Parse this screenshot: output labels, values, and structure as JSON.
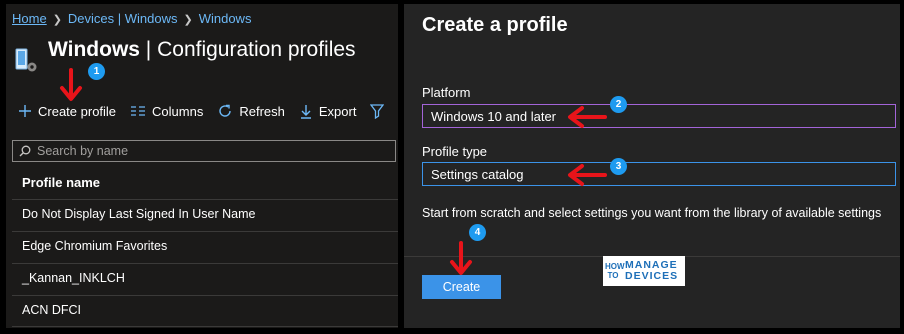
{
  "breadcrumb": {
    "home": "Home",
    "devices": "Devices | Windows",
    "windows": "Windows"
  },
  "page": {
    "title_main": "Windows",
    "title_sep": " | ",
    "title_sub": "Configuration profiles"
  },
  "toolbar": {
    "create_profile": "Create profile",
    "columns": "Columns",
    "refresh": "Refresh",
    "export": "Export"
  },
  "search": {
    "placeholder": "Search by name"
  },
  "table": {
    "column_header": "Profile name",
    "rows": [
      "Do Not Display Last Signed In User Name",
      "Edge Chromium Favorites",
      "_Kannan_INKLCH",
      "ACN DFCI"
    ]
  },
  "create_panel": {
    "title": "Create a profile",
    "platform_label": "Platform",
    "platform_value": "Windows 10 and later",
    "profile_type_label": "Profile type",
    "profile_type_value": "Settings catalog",
    "description": "Start from scratch and select settings you want from the library of available settings",
    "create_button": "Create"
  },
  "annotations": {
    "badges": [
      "1",
      "2",
      "3",
      "4"
    ],
    "arrow_color": "#e8141a",
    "badge_color": "#1e9bf0"
  },
  "watermark": {
    "how": "HOW",
    "to": "TO",
    "manage": "MANAGE",
    "devices": "DEVICES"
  },
  "colors": {
    "accent": "#3b93e8",
    "link": "#6cb8f6",
    "focus_border": "#a364d8"
  }
}
